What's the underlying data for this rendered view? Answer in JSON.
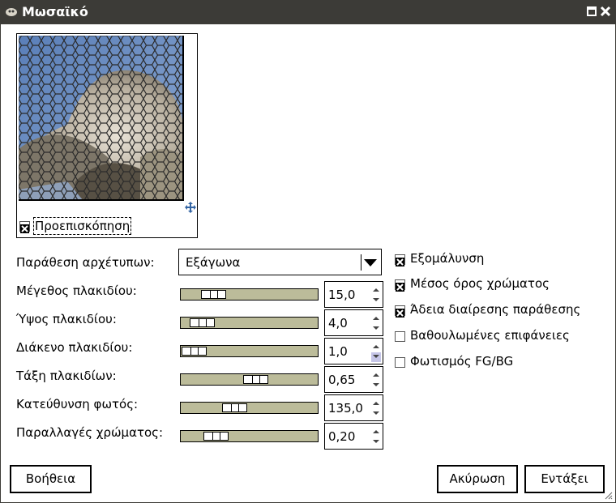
{
  "window": {
    "title": "Μωσαϊκό"
  },
  "preview": {
    "checkbox_label": "Προεπισκόπηση",
    "checked": true
  },
  "tiling": {
    "label": "Παράθεση αρχέτυπων",
    "value": "Εξάγωνα"
  },
  "params": [
    {
      "label": "Μέγεθος πλακιδίου:",
      "value": "15,0",
      "level": 0.18
    },
    {
      "label": "Ύψος πλακιδίου:",
      "value": "4,0",
      "level": 0.07
    },
    {
      "label": "Διάκενο πλακιδίου:",
      "value": "1,0",
      "level": 0.0
    },
    {
      "label": "Τάξη πλακιδίων:",
      "value": "0,65",
      "level": 0.56
    },
    {
      "label": "Κατεύθυνση φωτός:",
      "value": "135,0",
      "level": 0.37
    },
    {
      "label": "Παραλλαγές χρώματος:",
      "value": "0,20",
      "level": 0.2
    }
  ],
  "options": [
    {
      "label": "Εξομάλυνση",
      "checked": true
    },
    {
      "label": "Μέσος όρος χρώματος",
      "checked": true
    },
    {
      "label": "Άδεια διαίρεσης παράθεσης",
      "checked": true
    },
    {
      "label": "Βαθουλωμένες επιφάνειες",
      "checked": false
    },
    {
      "label": "Φωτισμός FG/BG",
      "checked": false
    }
  ],
  "buttons": {
    "help": "Βοήθεια",
    "cancel": "Ακύρωση",
    "ok": "Εντάξει"
  }
}
